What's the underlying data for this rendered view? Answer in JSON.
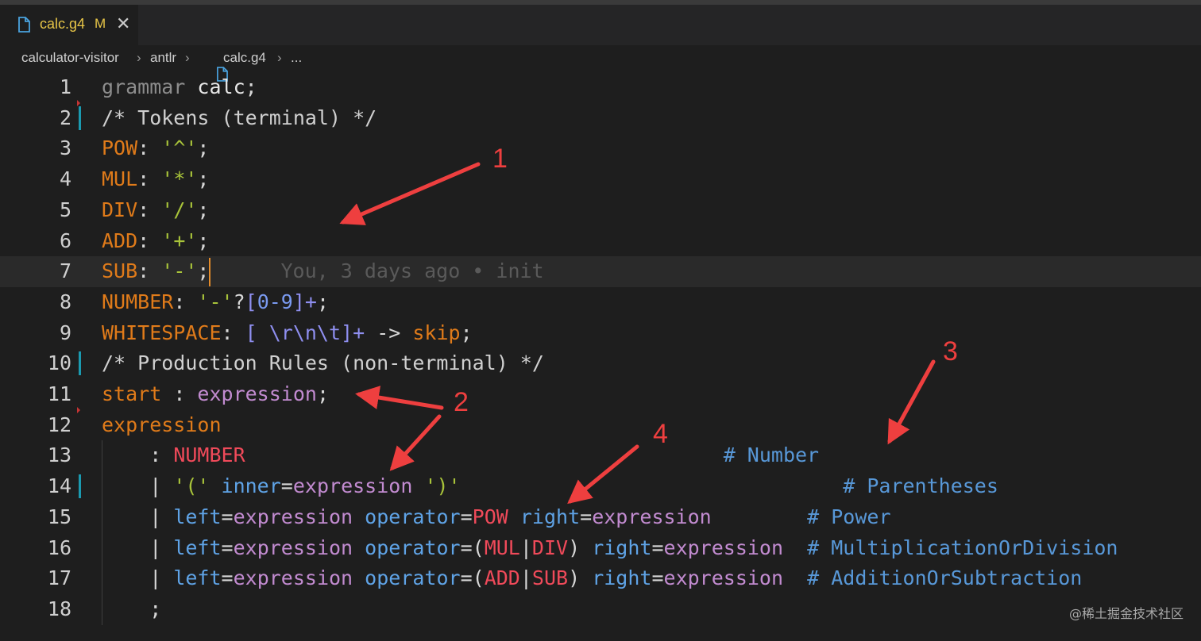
{
  "tab": {
    "filename": "calc.g4",
    "status": "M",
    "close_glyph": "✕"
  },
  "breadcrumb": {
    "items": [
      "calculator-visitor",
      "antlr",
      "calc.g4",
      "..."
    ]
  },
  "editor": {
    "current_line": 7,
    "blame": "You, 3 days ago • init",
    "lines": [
      {
        "n": "1",
        "segs": [
          [
            "kw",
            "grammar "
          ],
          [
            "wh",
            "calc"
          ],
          [
            "pun",
            ";"
          ]
        ]
      },
      {
        "n": "2",
        "segs": [
          [
            "cm",
            "/* Tokens (terminal) */"
          ]
        ]
      },
      {
        "n": "3",
        "segs": [
          [
            "tok",
            "POW"
          ],
          [
            "pun",
            ": "
          ],
          [
            "str",
            "'^'"
          ],
          [
            "pun",
            ";"
          ]
        ]
      },
      {
        "n": "4",
        "segs": [
          [
            "tok",
            "MUL"
          ],
          [
            "pun",
            ": "
          ],
          [
            "str",
            "'*'"
          ],
          [
            "pun",
            ";"
          ]
        ]
      },
      {
        "n": "5",
        "segs": [
          [
            "tok",
            "DIV"
          ],
          [
            "pun",
            ": "
          ],
          [
            "str",
            "'/'"
          ],
          [
            "pun",
            ";"
          ]
        ]
      },
      {
        "n": "6",
        "segs": [
          [
            "tok",
            "ADD"
          ],
          [
            "pun",
            ": "
          ],
          [
            "str",
            "'+'"
          ],
          [
            "pun",
            ";"
          ]
        ]
      },
      {
        "n": "7",
        "segs": [
          [
            "tok",
            "SUB"
          ],
          [
            "pun",
            ": "
          ],
          [
            "str",
            "'-'"
          ],
          [
            "pun",
            ";"
          ]
        ]
      },
      {
        "n": "8",
        "segs": [
          [
            "tok",
            "NUMBER"
          ],
          [
            "pun",
            ": "
          ],
          [
            "str",
            "'-'"
          ],
          [
            "pun",
            "?"
          ],
          [
            "br",
            "["
          ],
          [
            "num",
            "0-9"
          ],
          [
            "br",
            "]+"
          ],
          [
            "pun",
            ";"
          ]
        ]
      },
      {
        "n": "9",
        "segs": [
          [
            "tok",
            "WHITESPACE"
          ],
          [
            "pun",
            ": "
          ],
          [
            "br",
            "[ \\r\\n\\t]+"
          ],
          [
            "pun",
            " -> "
          ],
          [
            "tok",
            "skip"
          ],
          [
            "pun",
            ";"
          ]
        ]
      },
      {
        "n": "10",
        "segs": [
          [
            "cm",
            "/* Production Rules (non-terminal) */"
          ]
        ]
      },
      {
        "n": "11",
        "segs": [
          [
            "tok",
            "start"
          ],
          [
            "pun",
            " : "
          ],
          [
            "rl",
            "expression"
          ],
          [
            "pun",
            ";"
          ]
        ]
      },
      {
        "n": "12",
        "segs": [
          [
            "tok",
            "expression"
          ]
        ]
      },
      {
        "n": "13",
        "segs": [
          [
            "pun",
            "    : "
          ],
          [
            "red",
            "NUMBER"
          ],
          [
            "pun",
            "                                        "
          ],
          [
            "hash",
            "# Number"
          ]
        ]
      },
      {
        "n": "14",
        "segs": [
          [
            "pun",
            "    | "
          ],
          [
            "str",
            "'('"
          ],
          [
            "pun",
            " "
          ],
          [
            "bl",
            "inner"
          ],
          [
            "pun",
            "="
          ],
          [
            "rl",
            "expression"
          ],
          [
            "pun",
            " "
          ],
          [
            "str",
            "')'"
          ],
          [
            "pun",
            "                                "
          ],
          [
            "hash",
            "# Parentheses"
          ]
        ]
      },
      {
        "n": "15",
        "segs": [
          [
            "pun",
            "    | "
          ],
          [
            "bl",
            "left"
          ],
          [
            "pun",
            "="
          ],
          [
            "rl",
            "expression"
          ],
          [
            "pun",
            " "
          ],
          [
            "bl",
            "operator"
          ],
          [
            "pun",
            "="
          ],
          [
            "red",
            "POW"
          ],
          [
            "pun",
            " "
          ],
          [
            "bl",
            "right"
          ],
          [
            "pun",
            "="
          ],
          [
            "rl",
            "expression"
          ],
          [
            "pun",
            "        "
          ],
          [
            "hash",
            "# Power"
          ]
        ]
      },
      {
        "n": "16",
        "segs": [
          [
            "pun",
            "    | "
          ],
          [
            "bl",
            "left"
          ],
          [
            "pun",
            "="
          ],
          [
            "rl",
            "expression"
          ],
          [
            "pun",
            " "
          ],
          [
            "bl",
            "operator"
          ],
          [
            "pun",
            "=("
          ],
          [
            "red",
            "MUL"
          ],
          [
            "pun",
            "|"
          ],
          [
            "red",
            "DIV"
          ],
          [
            "pun",
            ") "
          ],
          [
            "bl",
            "right"
          ],
          [
            "pun",
            "="
          ],
          [
            "rl",
            "expression"
          ],
          [
            "pun",
            "  "
          ],
          [
            "hash",
            "# MultiplicationOrDivision"
          ]
        ]
      },
      {
        "n": "17",
        "segs": [
          [
            "pun",
            "    | "
          ],
          [
            "bl",
            "left"
          ],
          [
            "pun",
            "="
          ],
          [
            "rl",
            "expression"
          ],
          [
            "pun",
            " "
          ],
          [
            "bl",
            "operator"
          ],
          [
            "pun",
            "=("
          ],
          [
            "red",
            "ADD"
          ],
          [
            "pun",
            "|"
          ],
          [
            "red",
            "SUB"
          ],
          [
            "pun",
            ") "
          ],
          [
            "bl",
            "right"
          ],
          [
            "pun",
            "="
          ],
          [
            "rl",
            "expression"
          ],
          [
            "pun",
            "  "
          ],
          [
            "hash",
            "# AdditionOrSubtraction"
          ]
        ]
      },
      {
        "n": "18",
        "segs": [
          [
            "pun",
            "    ;"
          ]
        ]
      }
    ]
  },
  "annotations": [
    "1",
    "2",
    "3",
    "4"
  ],
  "watermark": "@稀土掘金技术社区",
  "colors": {
    "annotation": "#ee3f3f",
    "tab_modified": "#e7c547",
    "gutter_modified": "#1b9ab0",
    "editor_bg": "#1e1e1e"
  },
  "icons": {
    "tab_file": "file-icon",
    "breadcrumb_file": "file-icon"
  }
}
